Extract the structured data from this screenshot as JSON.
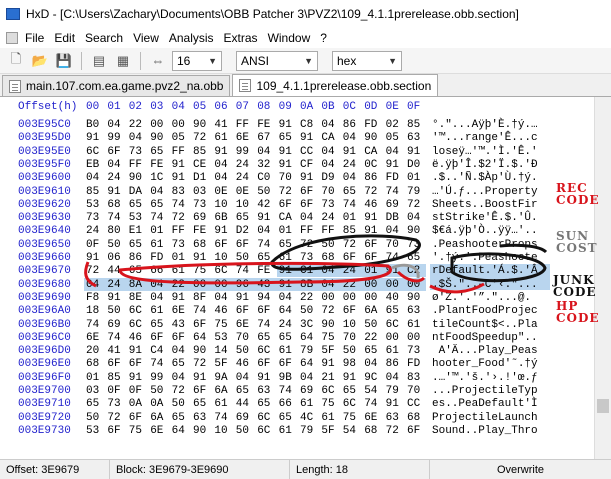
{
  "window": {
    "title": "HxD - [C:\\Users\\Zachary\\Documents\\OBB Patcher 3\\PVZ2\\109_4.1.1prerelease.obb.section]"
  },
  "menu": [
    "File",
    "Edit",
    "Search",
    "View",
    "Analysis",
    "Extras",
    "Window",
    "?"
  ],
  "toolbar": {
    "bytes_per_row": "16",
    "charset": "ANSI",
    "offset_base": "hex"
  },
  "tabs": [
    {
      "label": "main.107.com.ea.game.pvz2_na.obb",
      "active": false
    },
    {
      "label": "109_4.1.1prerelease.obb.section",
      "active": true
    }
  ],
  "editor": {
    "header_label": "Offset(h)",
    "columns": [
      "00",
      "01",
      "02",
      "03",
      "04",
      "05",
      "06",
      "07",
      "08",
      "09",
      "0A",
      "0B",
      "0C",
      "0D",
      "0E",
      "0F"
    ],
    "rows": [
      {
        "offset": "003E95C0",
        "hex": [
          "B0",
          "04",
          "22",
          "00",
          "00",
          "90",
          "41",
          "FF",
          "FE",
          "91",
          "C8",
          "04",
          "86",
          "FD",
          "02",
          "85"
        ],
        "ascii": "°.\"...Aÿþ'È.†ý.…"
      },
      {
        "offset": "003E95D0",
        "hex": [
          "91",
          "99",
          "04",
          "90",
          "05",
          "72",
          "61",
          "6E",
          "67",
          "65",
          "91",
          "CA",
          "04",
          "90",
          "05",
          "63"
        ],
        "ascii": "'™...range'Ê...c"
      },
      {
        "offset": "003E95E0",
        "hex": [
          "6C",
          "6F",
          "73",
          "65",
          "FF",
          "85",
          "91",
          "99",
          "04",
          "91",
          "CC",
          "04",
          "91",
          "CA",
          "04",
          "91"
        ],
        "ascii": "loseÿ…'™.'Ì.'Ê.'"
      },
      {
        "offset": "003E95F0",
        "hex": [
          "EB",
          "04",
          "FF",
          "FE",
          "91",
          "CE",
          "04",
          "24",
          "32",
          "91",
          "CF",
          "04",
          "24",
          "0C",
          "91",
          "D0"
        ],
        "ascii": "ë.ÿþ'Î.$2'Ï.$.'Ð"
      },
      {
        "offset": "003E9600",
        "hex": [
          "04",
          "24",
          "90",
          "1C",
          "91",
          "D1",
          "04",
          "24",
          "C0",
          "70",
          "91",
          "D9",
          "04",
          "86",
          "FD",
          "01"
        ],
        "ascii": ".$..'Ñ.$Àp'Ù.†ý."
      },
      {
        "offset": "003E9610",
        "hex": [
          "85",
          "91",
          "DA",
          "04",
          "83",
          "03",
          "0E",
          "0E",
          "50",
          "72",
          "6F",
          "70",
          "65",
          "72",
          "74",
          "79"
        ],
        "ascii": "…'Ú.ƒ...Property"
      },
      {
        "offset": "003E9620",
        "hex": [
          "53",
          "68",
          "65",
          "65",
          "74",
          "73",
          "10",
          "10",
          "42",
          "6F",
          "6F",
          "73",
          "74",
          "46",
          "69",
          "72"
        ],
        "ascii": "Sheets..BoostFir"
      },
      {
        "offset": "003E9630",
        "hex": [
          "73",
          "74",
          "53",
          "74",
          "72",
          "69",
          "6B",
          "65",
          "91",
          "CA",
          "04",
          "24",
          "01",
          "91",
          "DB",
          "04"
        ],
        "ascii": "stStrike'Ê.$.'Û."
      },
      {
        "offset": "003E9640",
        "hex": [
          "24",
          "80",
          "E1",
          "01",
          "FF",
          "FE",
          "91",
          "D2",
          "04",
          "01",
          "FF",
          "FF",
          "85",
          "91",
          "04",
          "90"
        ],
        "ascii": "$€á.ÿþ'Ò..ÿÿ…'.."
      },
      {
        "offset": "003E9650",
        "hex": [
          "0F",
          "50",
          "65",
          "61",
          "73",
          "68",
          "6F",
          "6F",
          "74",
          "65",
          "72",
          "50",
          "72",
          "6F",
          "70",
          "73"
        ],
        "ascii": ".PeashooterProps"
      },
      {
        "offset": "003E9660",
        "hex": [
          "91",
          "06",
          "86",
          "FD",
          "01",
          "91",
          "10",
          "50",
          "65",
          "61",
          "73",
          "68",
          "6F",
          "6F",
          "74",
          "65"
        ],
        "ascii": "'.†ý.'.Peashoote"
      },
      {
        "offset": "003E9670",
        "hex": [
          "72",
          "44",
          "65",
          "66",
          "61",
          "75",
          "6C",
          "74",
          "FE",
          "91",
          "C1",
          "04",
          "24",
          "01",
          "91",
          "C2"
        ],
        "ascii": "rDefault.'Á.$.'Â"
      },
      {
        "offset": "003E9680",
        "hex": [
          "04",
          "24",
          "8A",
          "04",
          "22",
          "00",
          "00",
          "96",
          "43",
          "91",
          "8B",
          "04",
          "22",
          "00",
          "00",
          "00"
        ],
        "ascii": ".$Š.\"..–C'‹.\"..."
      },
      {
        "offset": "003E9690",
        "hex": [
          "F8",
          "91",
          "8E",
          "04",
          "91",
          "8F",
          "04",
          "91",
          "94",
          "04",
          "22",
          "00",
          "00",
          "00",
          "40",
          "90"
        ],
        "ascii": "ø'Ž.'.'”.\"...@."
      },
      {
        "offset": "003E96A0",
        "hex": [
          "18",
          "50",
          "6C",
          "61",
          "6E",
          "74",
          "46",
          "6F",
          "6F",
          "64",
          "50",
          "72",
          "6F",
          "6A",
          "65",
          "63"
        ],
        "ascii": ".PlantFoodProjec"
      },
      {
        "offset": "003E96B0",
        "hex": [
          "74",
          "69",
          "6C",
          "65",
          "43",
          "6F",
          "75",
          "6E",
          "74",
          "24",
          "3C",
          "90",
          "10",
          "50",
          "6C",
          "61"
        ],
        "ascii": "tileCount$<..Pla"
      },
      {
        "offset": "003E96C0",
        "hex": [
          "6E",
          "74",
          "46",
          "6F",
          "6F",
          "64",
          "53",
          "70",
          "65",
          "65",
          "64",
          "75",
          "70",
          "22",
          "00",
          "00"
        ],
        "ascii": "ntFoodSpeedup\".."
      },
      {
        "offset": "003E96D0",
        "hex": [
          "20",
          "41",
          "91",
          "C4",
          "04",
          "90",
          "14",
          "50",
          "6C",
          "61",
          "79",
          "5F",
          "50",
          "65",
          "61",
          "73"
        ],
        "ascii": " A'Ä...Play_Peas"
      },
      {
        "offset": "003E96E0",
        "hex": [
          "68",
          "6F",
          "6F",
          "74",
          "65",
          "72",
          "5F",
          "46",
          "6F",
          "6F",
          "64",
          "91",
          "98",
          "04",
          "86",
          "FD"
        ],
        "ascii": "hooter_Food'˜.†ý"
      },
      {
        "offset": "003E96F0",
        "hex": [
          "01",
          "85",
          "91",
          "99",
          "04",
          "91",
          "9A",
          "04",
          "91",
          "9B",
          "04",
          "21",
          "91",
          "9C",
          "04",
          "83"
        ],
        "ascii": ".…'™.'š.'›.!'œ.ƒ"
      },
      {
        "offset": "003E9700",
        "hex": [
          "03",
          "0F",
          "0F",
          "50",
          "72",
          "6F",
          "6A",
          "65",
          "63",
          "74",
          "69",
          "6C",
          "65",
          "54",
          "79",
          "70"
        ],
        "ascii": "...ProjectileTyp"
      },
      {
        "offset": "003E9710",
        "hex": [
          "65",
          "73",
          "0A",
          "0A",
          "50",
          "65",
          "61",
          "44",
          "65",
          "66",
          "61",
          "75",
          "6C",
          "74",
          "91",
          "CC"
        ],
        "ascii": "es..PeaDefault'Ì"
      },
      {
        "offset": "003E9720",
        "hex": [
          "50",
          "72",
          "6F",
          "6A",
          "65",
          "63",
          "74",
          "69",
          "6C",
          "65",
          "4C",
          "61",
          "75",
          "6E",
          "63",
          "68"
        ],
        "ascii": "ProjectileLaunch"
      },
      {
        "offset": "003E9730",
        "hex": [
          "53",
          "6F",
          "75",
          "6E",
          "64",
          "90",
          "10",
          "50",
          "6C",
          "61",
          "79",
          "5F",
          "54",
          "68",
          "72",
          "6F"
        ],
        "ascii": "Sound..Play_Thro"
      }
    ]
  },
  "annotations": {
    "rec": "REC",
    "rec_code": "CODE",
    "sun": "SUN",
    "sun_cost": "COST",
    "junk": "JUNK",
    "junk_code": "CODE",
    "hp": "HP",
    "hp_code": "CODE"
  },
  "status": {
    "offset": "Offset: 3E9679",
    "block": "Block: 3E9679-3E9690",
    "length": "Length: 18",
    "mode": "Overwrite"
  },
  "colors": {
    "offset_blue": "#1f1fcc",
    "selection": "#b9d5ee",
    "annotation_red": "#d8141c"
  }
}
